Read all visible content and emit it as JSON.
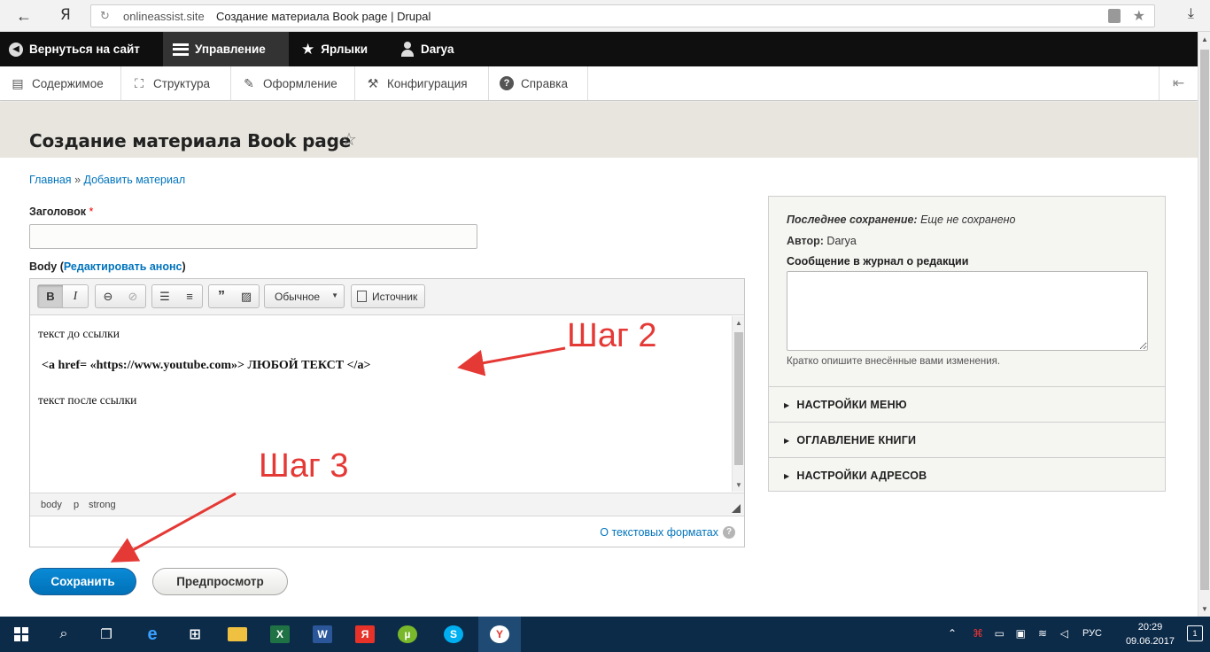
{
  "browser": {
    "domain": "onlineassist.site",
    "page_title": "Создание материала Book page | Drupal",
    "logo": "Я"
  },
  "toolbar": {
    "back_to_site": "Вернуться на сайт",
    "manage": "Управление",
    "shortcuts": "Ярлыки",
    "user": "Darya"
  },
  "tray": {
    "items": [
      {
        "label": "Содержимое",
        "icon": "content-icon"
      },
      {
        "label": "Структура",
        "icon": "structure-icon"
      },
      {
        "label": "Оформление",
        "icon": "appearance-icon"
      },
      {
        "label": "Конфигурация",
        "icon": "wrench-icon"
      },
      {
        "label": "Справка",
        "icon": "help-icon"
      }
    ]
  },
  "page": {
    "title": "Создание материала Book page",
    "breadcrumb": {
      "home": "Главная",
      "separator": "»",
      "add": "Добавить материал"
    }
  },
  "form": {
    "title_label": "Заголовок",
    "required_mark": "*",
    "title_value": "",
    "body_label": "Body",
    "body_paren_open": "(",
    "edit_summary": "Редактировать анонс",
    "body_paren_close": ")",
    "format_select": "Обычное",
    "source_label": "Источник",
    "bold_label": "B",
    "italic_label": "I",
    "body_lines": [
      "текст до ссылки",
      "<a href= «https://www.youtube.com»> ЛЮБОЙ ТЕКСТ  </a>",
      "текст после ссылки"
    ],
    "element_path": [
      "body",
      "p",
      "strong"
    ],
    "text_formats_link": "О текстовых форматах",
    "help_mark": "?",
    "save": "Сохранить",
    "preview": "Предпросмотр"
  },
  "annotations": {
    "step2": "Шаг 2",
    "step3": "Шаг 3",
    "arrow_color": "#e53935"
  },
  "sidebar": {
    "last_saved_label": "Последнее сохранение:",
    "last_saved_value": "Еще не сохранено",
    "author_label": "Автор:",
    "author_value": "Darya",
    "log_label": "Сообщение в журнал о редакции",
    "log_value": "",
    "log_hint": "Кратко опишите внесённые вами изменения.",
    "sections": [
      "НАСТРОЙКИ МЕНЮ",
      "ОГЛАВЛЕНИЕ КНИГИ",
      "НАСТРОЙКИ АДРЕСОВ"
    ]
  },
  "taskbar": {
    "apps": [
      "edge-icon",
      "store-icon",
      "explorer-icon",
      "excel-icon",
      "word-icon",
      "yandex-icon",
      "utorrent-icon",
      "skype-icon",
      "yandex-browser-icon"
    ],
    "language": "РУС",
    "time": "20:29",
    "date": "09.06.2017",
    "notifications": "1"
  }
}
